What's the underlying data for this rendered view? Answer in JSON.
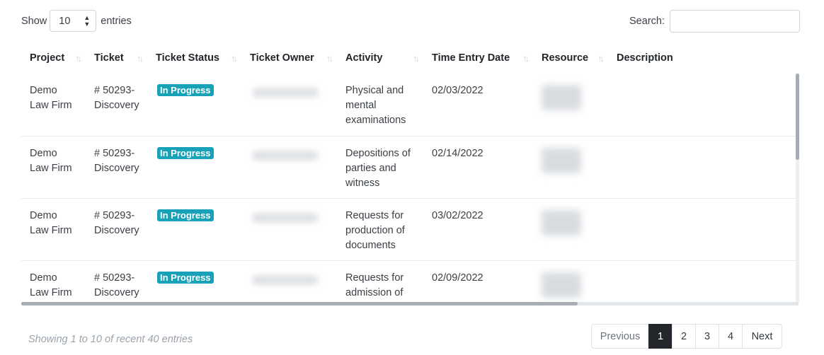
{
  "length_menu": {
    "show_label": "Show",
    "selected": "10",
    "entries_label": "entries"
  },
  "search": {
    "label": "Search:",
    "value": ""
  },
  "table": {
    "columns": [
      "Project",
      "Ticket",
      "Ticket Status",
      "Ticket Owner",
      "Activity",
      "Time Entry Date",
      "Resource",
      "Description"
    ],
    "rows": [
      {
        "project": "Demo Law Firm",
        "ticket": "# 50293-Discovery",
        "status": "In Progress",
        "owner": "",
        "activity": "Physical and mental examinations",
        "date": "02/03/2022",
        "resource": "",
        "description": ""
      },
      {
        "project": "Demo Law Firm",
        "ticket": "# 50293-Discovery",
        "status": "In Progress",
        "owner": "",
        "activity": "Depositions of parties and witness",
        "date": "02/14/2022",
        "resource": "",
        "description": ""
      },
      {
        "project": "Demo Law Firm",
        "ticket": "# 50293-Discovery",
        "status": "In Progress",
        "owner": "",
        "activity": "Requests for production of documents",
        "date": "03/02/2022",
        "resource": "",
        "description": ""
      },
      {
        "project": "Demo Law Firm",
        "ticket": "# 50293-Discovery",
        "status": "In Progress",
        "owner": "",
        "activity": "Requests for admission of",
        "date": "02/09/2022",
        "resource": "",
        "description": ""
      }
    ],
    "status_color": "#17a2b8"
  },
  "info": "Showing 1 to 10 of recent 40 entries",
  "pagination": {
    "previous": "Previous",
    "pages": [
      "1",
      "2",
      "3",
      "4"
    ],
    "current": "1",
    "next": "Next"
  }
}
